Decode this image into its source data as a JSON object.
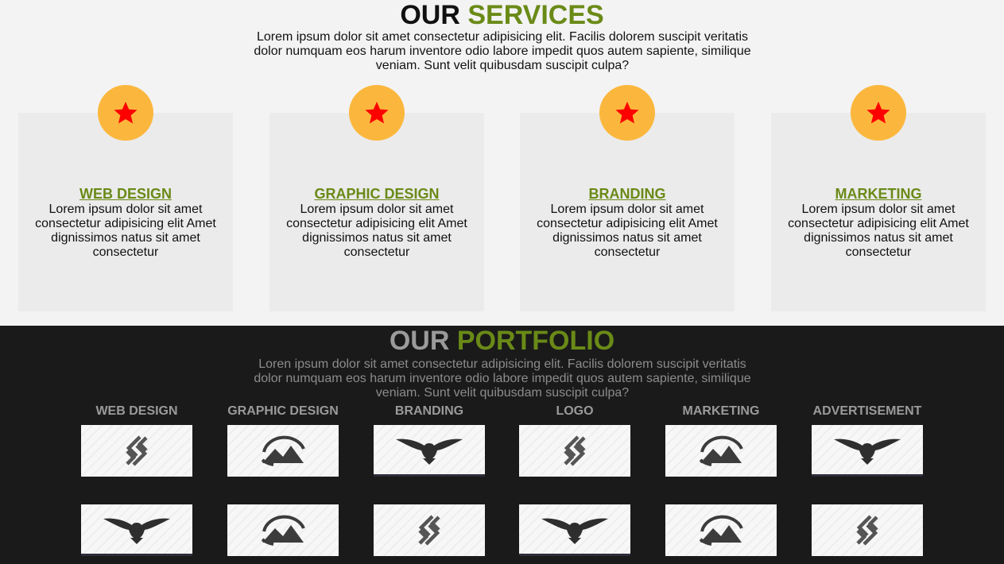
{
  "services": {
    "title_main": "OUR",
    "title_accent": "SERVICES",
    "intro": "Lorem ipsum dolor sit amet consectetur adipisicing elit. Facilis dolorem suscipit veritatis dolor numquam eos harum inventore odio labore impedit quos autem sapiente, similique veniam. Sunt velit quibusdam suscipit culpa?",
    "cards": [
      {
        "title": "WEB DESIGN",
        "text": "Lorem ipsum dolor sit amet consectetur adipisicing elit Amet dignissimos natus sit amet consectetur",
        "icon": "star-icon"
      },
      {
        "title": "GRAPHIC DESIGN",
        "text": "Lorem ipsum dolor sit amet consectetur adipisicing elit Amet dignissimos natus sit amet consectetur",
        "icon": "star-icon"
      },
      {
        "title": "BRANDING",
        "text": "Lorem ipsum dolor sit amet consectetur adipisicing elit Amet dignissimos natus sit amet consectetur",
        "icon": "star-icon"
      },
      {
        "title": "MARKETING",
        "text": "Lorem ipsum dolor sit amet consectetur adipisicing elit Amet dignissimos natus sit amet consectetur",
        "icon": "star-icon"
      }
    ]
  },
  "portfolio": {
    "title_main": "OUR",
    "title_accent": "PORTFOLIO",
    "intro": "Loren ipsum dolor sit amet consectetur adipisicing elit. Facilis dolorem suscipit veritatis dolor numquam eos harum inventore odio labore impedit quos autem sapiente, similique veniam. Sunt velit quibusdam suscipit culpa?",
    "categories": [
      "WEB DESIGN",
      "GRAPHIC DESIGN",
      "BRANDING",
      "LOGO",
      "MARKETING",
      "ADVERTISEMENT"
    ],
    "grid": [
      [
        "s-logo-icon",
        "mountain-logo-icon",
        "eagle-logo-icon",
        "s-logo-icon",
        "mountain-logo-icon",
        "eagle-logo-icon"
      ],
      [
        "eagle-logo-icon",
        "mountain-logo-icon",
        "s-logo-icon",
        "eagle-logo-icon",
        "mountain-logo-icon",
        "s-logo-icon"
      ]
    ]
  },
  "colors": {
    "accent": "#6a8a17",
    "badge": "#fbb73d",
    "star": "#ff0000",
    "card_bg": "#ebebeb",
    "dark_bg": "#1a1a1a"
  }
}
